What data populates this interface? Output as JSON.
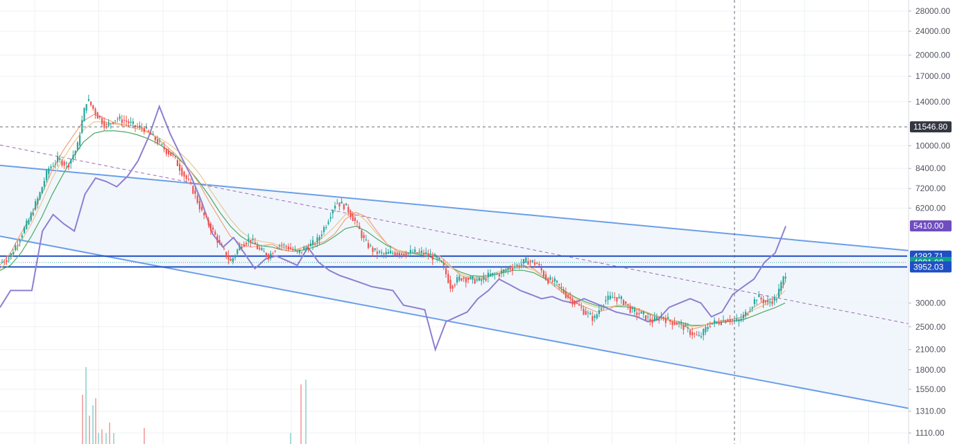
{
  "colors": {
    "channel": "#6b9ee8",
    "channel_fill": "#eef4fc",
    "midline": "#9c6ab2",
    "hline": "#1f4fc4",
    "up": "#26a69a",
    "down": "#ef5350",
    "ma_fast": "#f2a07b",
    "ma_mid": "#e8c890",
    "ma_slow": "#4aa860",
    "overlay": "#8c7fd1",
    "volume_up": "#9fd6cf",
    "volume_down": "#f3a6a6",
    "grid": "#eef0f3",
    "crosshair": "#666b76",
    "axis_text": "#50535e"
  },
  "chart_data": {
    "type": "line",
    "y_axis": {
      "scale": "log",
      "ticks": [
        "28000.00",
        "24000.00",
        "20000.00",
        "17000.00",
        "14000.00",
        "10000.00",
        "8400.00",
        "7200.00",
        "6200.00",
        "3000.00",
        "2500.00",
        "2100.00",
        "1800.00",
        "1550.00",
        "1310.00",
        "1110.00"
      ],
      "ylim": [
        1050,
        32000
      ]
    },
    "price_badges": [
      {
        "value": "11546.80",
        "color": "#333741"
      },
      {
        "value": "5410.00",
        "color": "#6f4dbf"
      },
      {
        "value": "4292.71",
        "color": "#1f4fc4"
      },
      {
        "value": "4091.00",
        "color": "#12a08e"
      },
      {
        "value": "3952.03",
        "color": "#1f4fc4"
      }
    ],
    "horizontal_levels": [
      4292.71,
      3952.03
    ],
    "current_price": 4091.0,
    "crosshair_price": 11546.8,
    "channel": {
      "upper": [
        [
          0,
          8600
        ],
        [
          1310,
          4480
        ]
      ],
      "lower": [
        [
          0,
          5000
        ],
        [
          1310,
          1340
        ]
      ],
      "middle": [
        [
          0,
          10050
        ],
        [
          1310,
          2560
        ]
      ]
    },
    "series": [
      {
        "name": "",
        "kind": "candles",
        "values": [
          4080,
          4300,
          4950,
          5700,
          6800,
          8400,
          9000,
          8600,
          9900,
          14300,
          12700,
          11600,
          12300,
          12100,
          11600,
          11400,
          10600,
          9800,
          9200,
          8100,
          7200,
          6000,
          5300,
          4600,
          4100,
          4650,
          4900,
          4500,
          4300,
          4700,
          4600,
          4400,
          4600,
          4800,
          5500,
          6500,
          6300,
          5600,
          4800,
          4450,
          4350,
          4420,
          4370,
          4420,
          4400,
          4300,
          4100,
          3400,
          3650,
          3600,
          3550,
          3700,
          3750,
          3900,
          4000,
          4150,
          4050,
          3600,
          3500,
          3200,
          3000,
          2800,
          2650,
          3050,
          3150,
          3050,
          2800,
          2750,
          2600,
          2700,
          2600,
          2550,
          2400,
          2300,
          2550,
          2600,
          2650,
          2600,
          2800,
          3150,
          3000,
          3100,
          3800
        ]
      },
      {
        "name": "",
        "kind": "overlay",
        "values": [
          2900,
          3300,
          3300,
          3300,
          5200,
          5900,
          5500,
          5200,
          6900,
          7800,
          7600,
          7300,
          7900,
          8900,
          10700,
          13500,
          11000,
          9300,
          7900,
          6500,
          5100,
          4600,
          4950,
          4400,
          3900,
          4200,
          4300,
          4150,
          4000,
          4600,
          4100,
          3850,
          3700,
          3600,
          3500,
          3400,
          3350,
          3300,
          2950,
          2900,
          2850,
          2100,
          2600,
          2700,
          2800,
          3100,
          3300,
          3600,
          3450,
          3300,
          3200,
          3100,
          3150,
          3050,
          3000,
          3100,
          3000,
          2900,
          2800,
          2750,
          2700,
          2600,
          2650,
          2900,
          3000,
          3100,
          3000,
          2700,
          2800,
          3200,
          3400,
          3600,
          4100,
          4400,
          5400
        ]
      },
      {
        "name": "",
        "kind": "ma_fast",
        "values": [
          4000,
          4400,
          5100,
          5900,
          6900,
          8300,
          9600,
          10800,
          12100,
          12700,
          12300,
          11900,
          11700,
          11600,
          11200,
          10600,
          9900,
          9200,
          8400,
          7500,
          6500,
          5700,
          5000,
          4700,
          4600,
          4650,
          4700,
          4500,
          4450,
          4600,
          4700,
          4800,
          5100,
          5700,
          6000,
          5800,
          5200,
          4700,
          4450,
          4380,
          4390,
          4370,
          4300,
          4000,
          3700,
          3600,
          3600,
          3700,
          3800,
          3950,
          4000,
          3900,
          3650,
          3400,
          3200,
          3000,
          2900,
          2800,
          2850,
          2950,
          2950,
          2850,
          2750,
          2680,
          2620,
          2550,
          2450,
          2500,
          2580,
          2620,
          2650,
          2700,
          2900,
          3050,
          3100,
          3500
        ]
      },
      {
        "name": "",
        "kind": "ma_mid",
        "values": [
          3900,
          4200,
          4800,
          5500,
          6500,
          7800,
          9000,
          10200,
          11300,
          12000,
          12000,
          11800,
          11600,
          11400,
          11100,
          10700,
          10200,
          9600,
          8900,
          8100,
          7200,
          6400,
          5700,
          5200,
          4900,
          4800,
          4750,
          4600,
          4500,
          4600,
          4750,
          5000,
          5400,
          5900,
          6000,
          5600,
          5100,
          4700,
          4500,
          4420,
          4400,
          4350,
          4200,
          3950,
          3750,
          3650,
          3650,
          3750,
          3850,
          3950,
          3950,
          3850,
          3650,
          3450,
          3250,
          3100,
          2980,
          2900,
          2900,
          2950,
          2950,
          2870,
          2780,
          2700,
          2640,
          2580,
          2500,
          2520,
          2580,
          2620,
          2650,
          2700,
          2850,
          2950,
          3050,
          3300
        ]
      },
      {
        "name": "",
        "kind": "ma_slow",
        "values": [
          3850,
          4000,
          4400,
          5000,
          5800,
          6900,
          8000,
          9200,
          10300,
          11000,
          11200,
          11200,
          11100,
          10900,
          10600,
          10200,
          9700,
          9100,
          8400,
          7600,
          6800,
          6000,
          5400,
          5000,
          4750,
          4650,
          4600,
          4500,
          4450,
          4500,
          4600,
          4750,
          5000,
          5300,
          5400,
          5200,
          4900,
          4650,
          4500,
          4400,
          4350,
          4280,
          4150,
          3950,
          3800,
          3700,
          3680,
          3720,
          3780,
          3850,
          3850,
          3780,
          3620,
          3450,
          3280,
          3130,
          3020,
          2940,
          2910,
          2920,
          2910,
          2850,
          2770,
          2700,
          2640,
          2590,
          2530,
          2530,
          2560,
          2590,
          2610,
          2640,
          2720,
          2810,
          2890,
          3000
        ]
      }
    ]
  }
}
